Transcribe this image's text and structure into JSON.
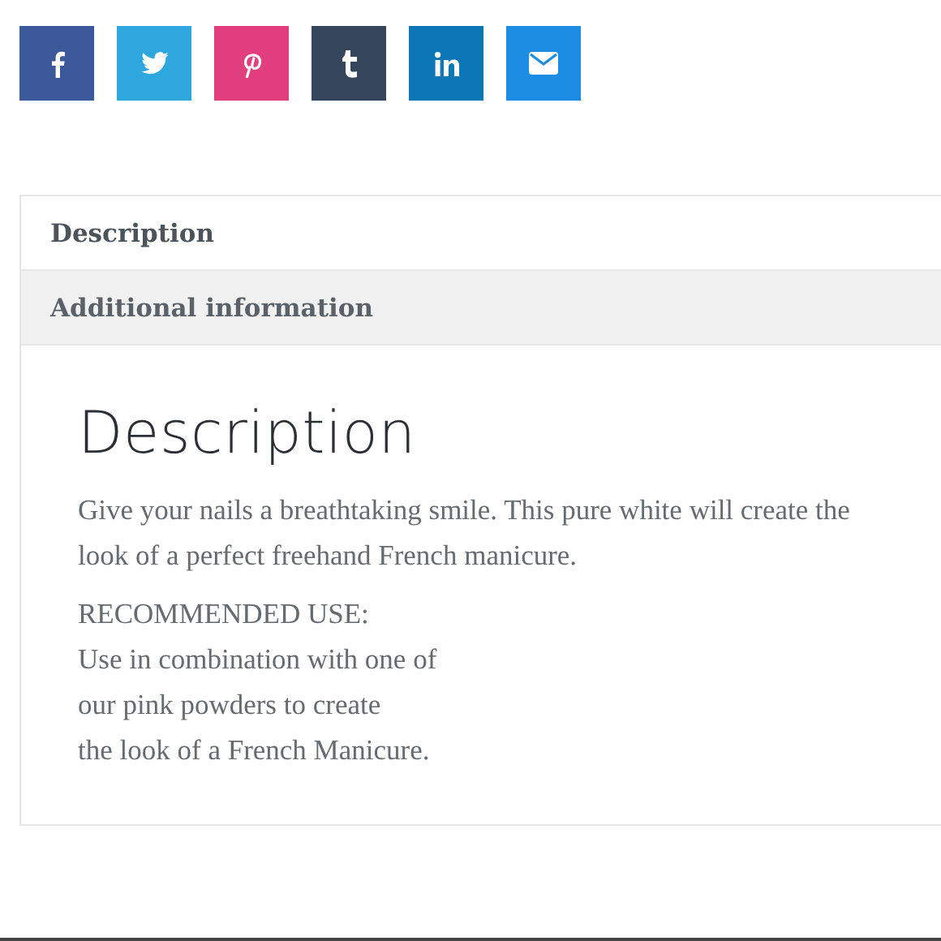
{
  "share_buttons": [
    {
      "kind": "facebook",
      "color": "#3b5998"
    },
    {
      "kind": "twitter",
      "color": "#2ea7df"
    },
    {
      "kind": "pinterest",
      "color": "#e23f7f"
    },
    {
      "kind": "tumblr",
      "color": "#35465c"
    },
    {
      "kind": "linkedin",
      "color": "#0b77b5"
    },
    {
      "kind": "email",
      "color": "#1d8de3"
    }
  ],
  "tabs": [
    {
      "label": "Description",
      "selected": true
    },
    {
      "label": "Additional information",
      "selected": false
    }
  ],
  "panel": {
    "heading": "Description",
    "paragraphs": [
      "Give your nails a breathtaking smile. This pure white will create the look of a perfect freehand French manicure.",
      "RECOMMENDED USE:\nUse in combination with one of\nour pink powders to create\nthe look of a French Manicure."
    ]
  }
}
